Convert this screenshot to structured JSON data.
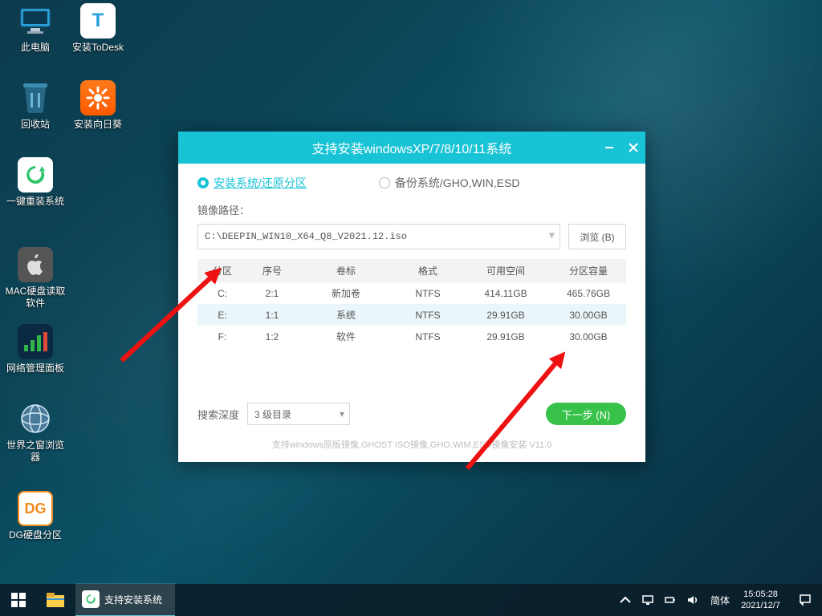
{
  "desktop_icons": [
    {
      "label": "此电脑"
    },
    {
      "label": "安装ToDesk"
    },
    {
      "label": "回收站"
    },
    {
      "label": "安装向日葵"
    },
    {
      "label": "一键重装系统"
    },
    {
      "label": "MAC硬盘读取软件"
    },
    {
      "label": "网络管理面板"
    },
    {
      "label": "世界之窗浏览器"
    },
    {
      "label": "DG硬盘分区"
    }
  ],
  "installer": {
    "title": "支持安装windowsXP/7/8/10/11系统",
    "radio_install": "安装系统/还原分区",
    "radio_backup": "备份系统/GHO,WIN,ESD",
    "path_label": "镜像路径：",
    "path_value": "C:\\DEEPIN_WIN10_X64_Q8_V2021.12.iso",
    "browse": "浏览 (B)",
    "headers": {
      "part": "分区",
      "index": "序号",
      "vol": "卷标",
      "fmt": "格式",
      "free": "可用空间",
      "cap": "分区容量"
    },
    "rows": [
      {
        "p": "C:",
        "i": "2:1",
        "v": "新加卷",
        "f": "NTFS",
        "free": "414.11GB",
        "cap": "465.76GB"
      },
      {
        "p": "E:",
        "i": "1:1",
        "v": "系统",
        "f": "NTFS",
        "free": "29.91GB",
        "cap": "30.00GB"
      },
      {
        "p": "F:",
        "i": "1:2",
        "v": "软件",
        "f": "NTFS",
        "free": "29.91GB",
        "cap": "30.00GB"
      }
    ],
    "depth_label": "搜索深度",
    "depth_value": "3 级目录",
    "next": "下一步 (N)",
    "footer": "支持windows原版镜像,GHOST ISO镜像,GHO,WIM,ESD镜像安装  V11.0"
  },
  "taskbar": {
    "app_label": "支持安装系统",
    "ime": "简体",
    "time": "15:05:28",
    "date": "2021/12/7"
  }
}
